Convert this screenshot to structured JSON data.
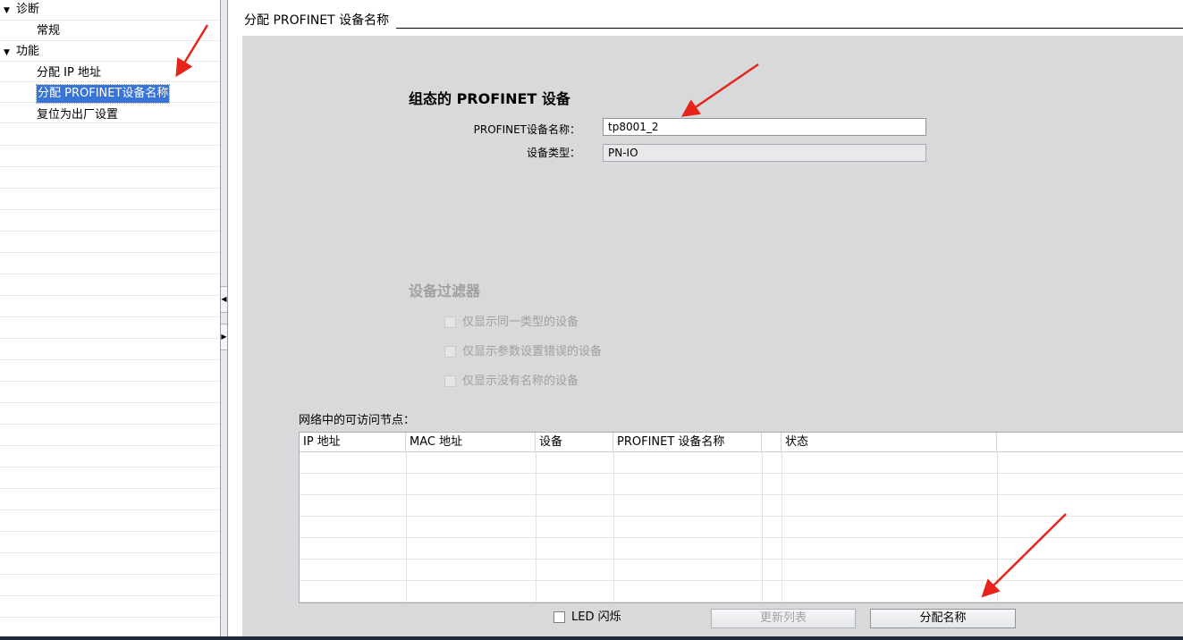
{
  "tree": {
    "items": [
      {
        "label": "诊断",
        "level": "top",
        "expanded": true
      },
      {
        "label": "常规",
        "level": "sub"
      },
      {
        "label": "功能",
        "level": "top",
        "expanded": true
      },
      {
        "label": "分配 IP 地址",
        "level": "sub"
      },
      {
        "label": "分配 PROFINET设备名称",
        "level": "sub",
        "selected": true
      },
      {
        "label": "复位为出厂设置",
        "level": "sub"
      }
    ]
  },
  "header": {
    "title": "分配 PROFINET 设备名称"
  },
  "configured_device": {
    "title": "组态的 PROFINET 设备",
    "name_label": "PROFINET设备名称：",
    "name_value": "tp8001_2",
    "type_label": "设备类型：",
    "type_value": "PN-IO"
  },
  "device_filter": {
    "title": "设备过滤器",
    "options": [
      {
        "label": "仅显示同一类型的设备",
        "checked": false
      },
      {
        "label": "仅显示参数设置错误的设备",
        "checked": false
      },
      {
        "label": "仅显示没有名称的设备",
        "checked": false
      }
    ]
  },
  "nodes_table": {
    "caption": "网络中的可访问节点：",
    "columns": [
      "IP 地址",
      "MAC 地址",
      "设备",
      "PROFINET 设备名称",
      "",
      "状态",
      ""
    ],
    "rows": []
  },
  "led_flash": {
    "label": "LED 闪烁",
    "checked": false
  },
  "buttons": {
    "update_list": "更新列表",
    "assign_name": "分配名称"
  },
  "colors": {
    "selection": "#3874d8",
    "arrow": "#e8231a",
    "panel_bg": "#d8d9da"
  }
}
